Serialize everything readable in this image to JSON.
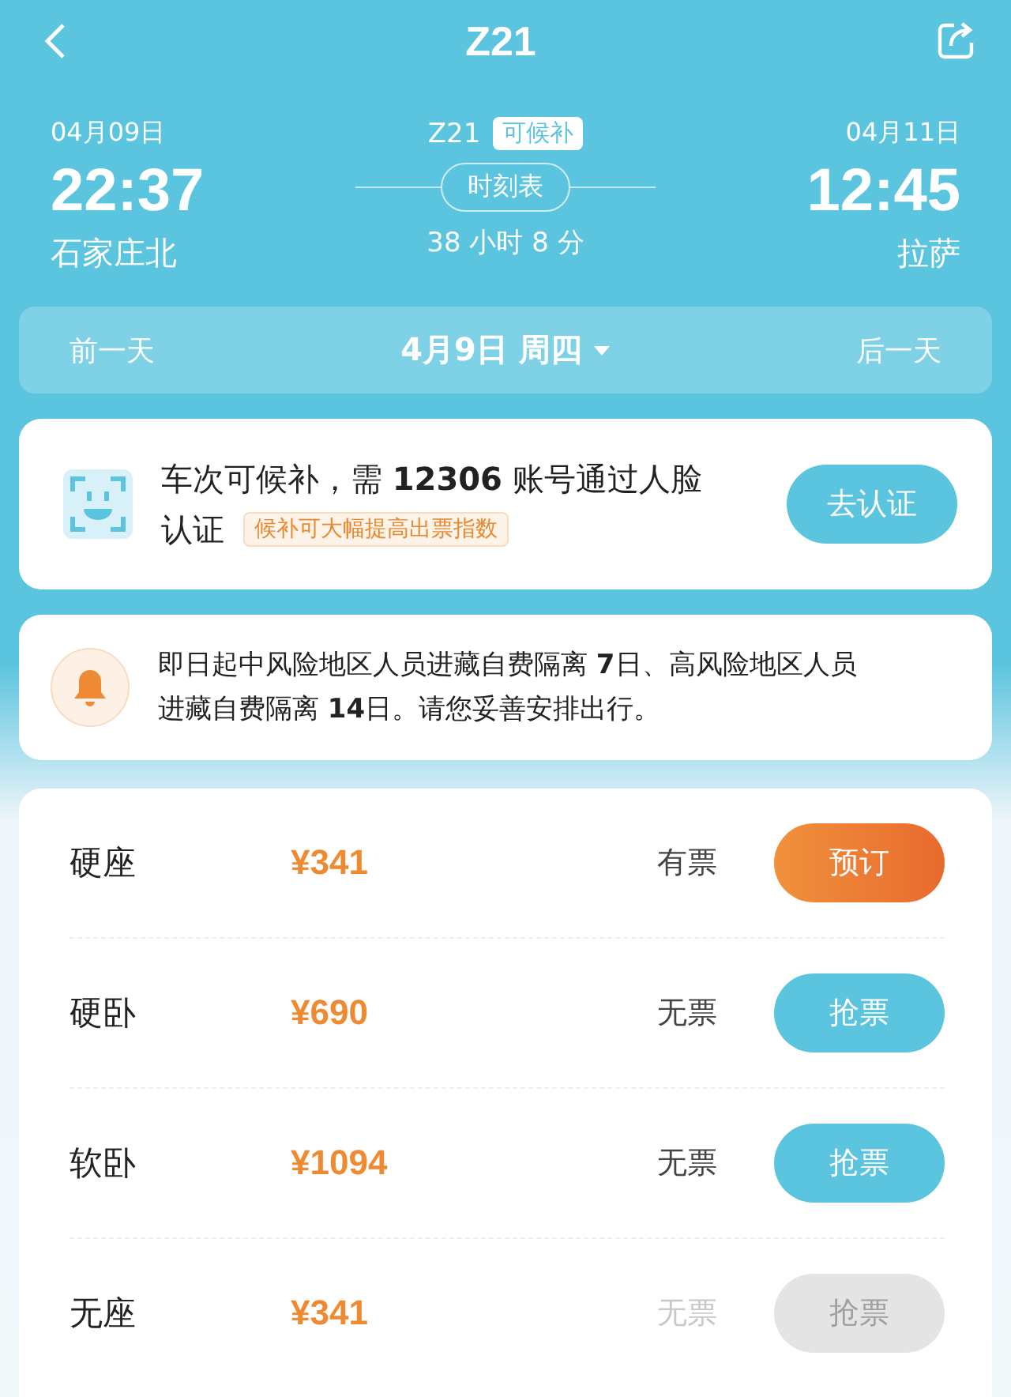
{
  "header": {
    "title": "Z21"
  },
  "journey": {
    "depart_date": "04月09日",
    "depart_time": "22:37",
    "depart_station": "石家庄北",
    "train": "Z21",
    "badge": "可候补",
    "timetable": "时刻表",
    "duration": "38 小时 8 分",
    "arrive_date": "04月11日",
    "arrive_time": "12:45",
    "arrive_station": "拉萨"
  },
  "date_bar": {
    "prev": "前一天",
    "current": "4月9日 周四",
    "next": "后一天"
  },
  "verify_card": {
    "message": "车次可候补，需 **12306** 账号通过人脸",
    "message_end": "认证",
    "tag": "候补可大幅提高出票指数",
    "button": "去认证"
  },
  "notice": {
    "text": "即日起中风险地区人员进藏自费隔离 **7**日、高风险地区人员进藏自费隔离 **14**日。请您妥善安排出行。"
  },
  "seats": [
    {
      "name": "硬座",
      "price": "¥341",
      "availability": "有票",
      "button": "预订",
      "kind": "book",
      "disabled": false
    },
    {
      "name": "硬卧",
      "price": "¥690",
      "availability": "无票",
      "button": "抢票",
      "kind": "grab",
      "disabled": false
    },
    {
      "name": "软卧",
      "price": "¥1094",
      "availability": "无票",
      "button": "抢票",
      "kind": "grab",
      "disabled": false
    },
    {
      "name": "无座",
      "price": "¥341",
      "availability": "无票",
      "button": "抢票",
      "kind": "grab",
      "disabled": true
    }
  ]
}
